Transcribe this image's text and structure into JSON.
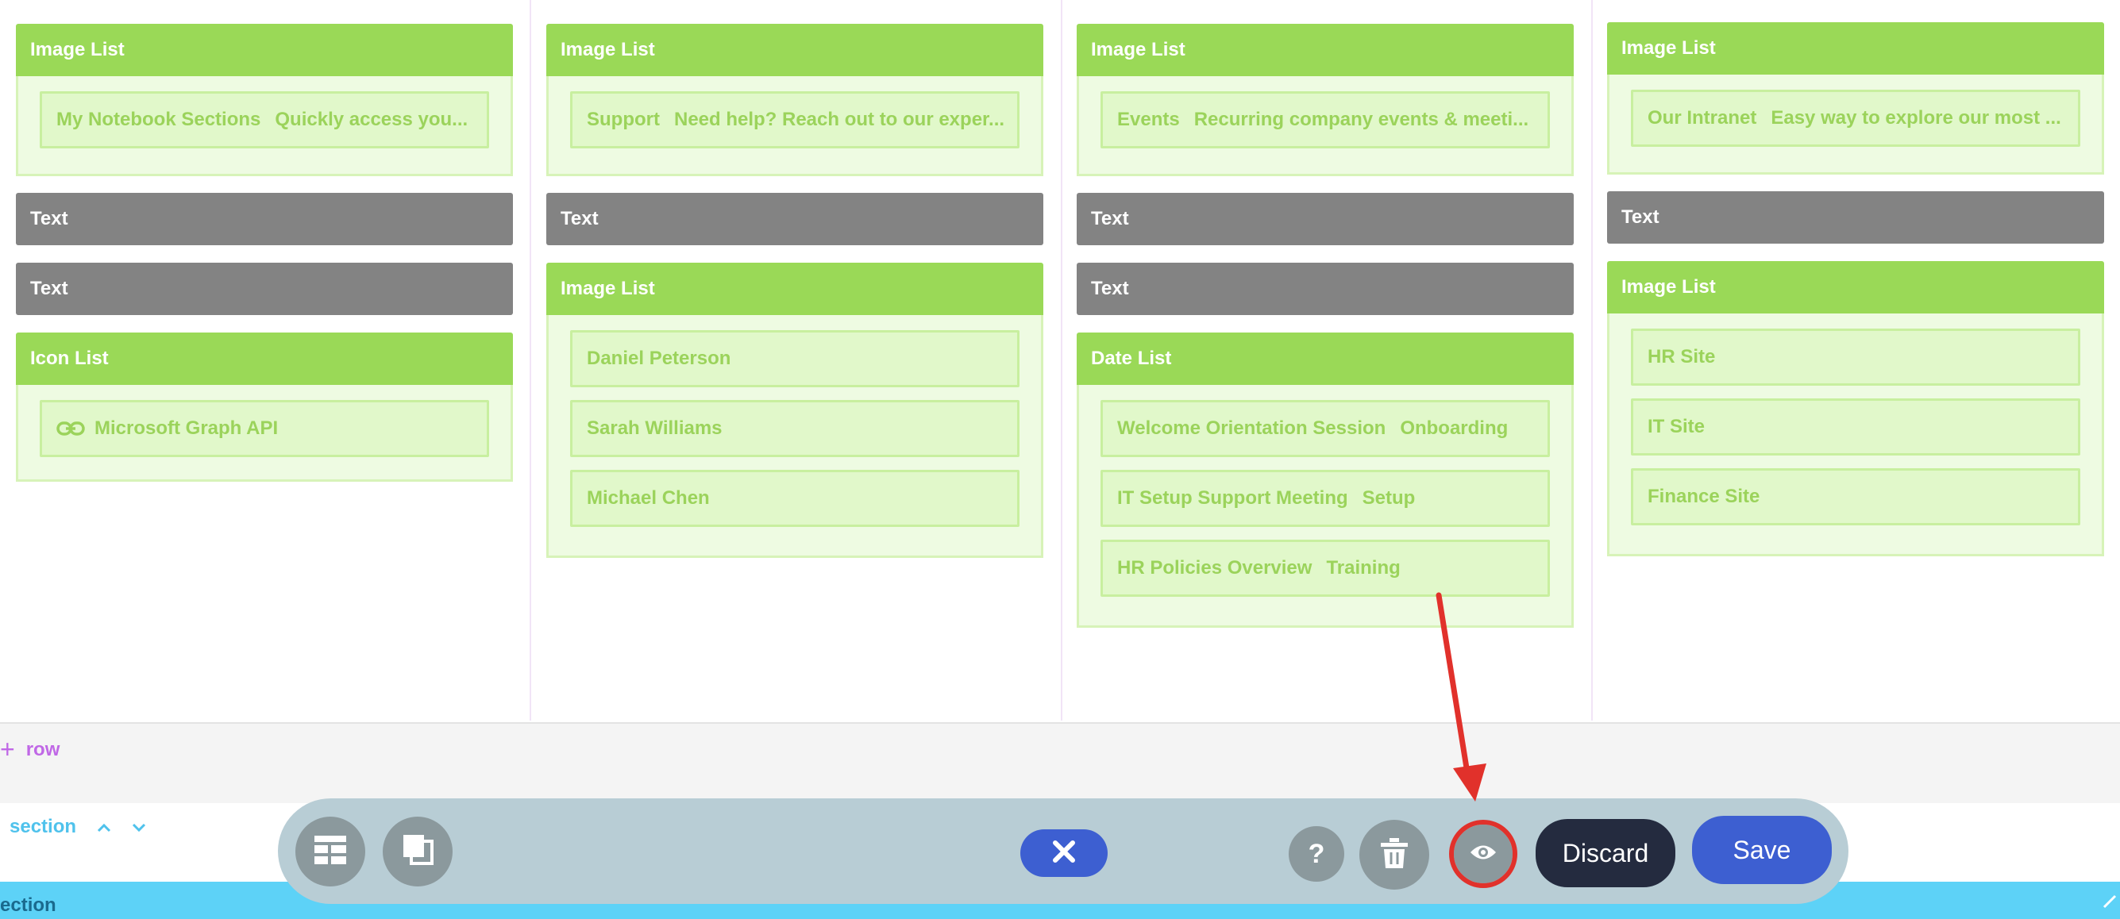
{
  "columns": [
    {
      "widgets": [
        {
          "kind": "image-list",
          "title": "Image List",
          "items": [
            {
              "label": "My Notebook Sections",
              "sub": "Quickly access you..."
            }
          ]
        },
        {
          "kind": "text",
          "title": "Text"
        },
        {
          "kind": "text",
          "title": "Text"
        },
        {
          "kind": "icon-list",
          "title": "Icon List",
          "items": [
            {
              "label": "Microsoft Graph API",
              "icon": "link-icon"
            }
          ]
        }
      ]
    },
    {
      "widgets": [
        {
          "kind": "image-list",
          "title": "Image List",
          "items": [
            {
              "label": "Support",
              "sub": "Need help? Reach out to our exper..."
            }
          ]
        },
        {
          "kind": "text",
          "title": "Text"
        },
        {
          "kind": "image-list",
          "title": "Image List",
          "items": [
            {
              "label": "Daniel Peterson"
            },
            {
              "label": "Sarah Williams"
            },
            {
              "label": "Michael Chen"
            }
          ]
        }
      ]
    },
    {
      "widgets": [
        {
          "kind": "image-list",
          "title": "Image List",
          "items": [
            {
              "label": "Events",
              "sub": "Recurring company events & meeti..."
            }
          ]
        },
        {
          "kind": "text",
          "title": "Text"
        },
        {
          "kind": "text",
          "title": "Text"
        },
        {
          "kind": "date-list",
          "title": "Date List",
          "items": [
            {
              "label": "Welcome Orientation Session",
              "tag": "Onboarding"
            },
            {
              "label": "IT Setup Support Meeting",
              "tag": "Setup"
            },
            {
              "label": "HR Policies Overview",
              "tag": "Training"
            }
          ]
        }
      ]
    },
    {
      "widgets": [
        {
          "kind": "image-list",
          "title": "Image List",
          "items": [
            {
              "label": "Our Intranet",
              "sub": "Easy way to explore our most ..."
            }
          ]
        },
        {
          "kind": "text",
          "title": "Text"
        },
        {
          "kind": "image-list",
          "title": "Image List",
          "items": [
            {
              "label": "HR Site"
            },
            {
              "label": "IT Site"
            },
            {
              "label": "Finance Site"
            }
          ]
        }
      ]
    }
  ],
  "add_row_label": "row",
  "section_label": "section",
  "section_bar_label": "ection",
  "toolbar": {
    "layout_icon": "layout-icon",
    "duplicate_icon": "duplicate-icon",
    "close_icon": "close-icon",
    "help_icon": "help-icon",
    "delete_icon": "trash-icon",
    "preview_icon": "eye-icon",
    "discard_label": "Discard",
    "save_label": "Save"
  },
  "colors": {
    "widget_header_green": "#9ad957",
    "widget_header_gray": "#838383",
    "item_text": "#9bd35b",
    "toolbar_bg": "#b8cdd5",
    "primary_blue": "#3d5fd1",
    "discard_dark": "#242b3f",
    "highlight_red": "#e1312b",
    "section_bar": "#5dd2f7",
    "add_row_purple": "#c068e6"
  }
}
